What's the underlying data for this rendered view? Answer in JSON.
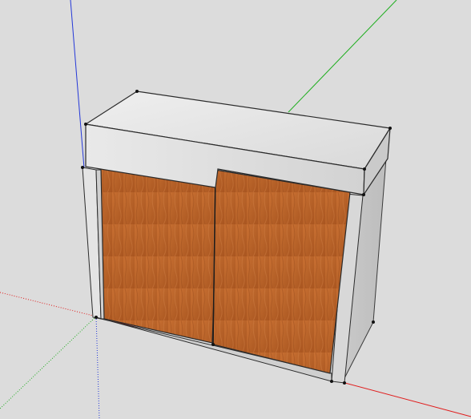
{
  "scene": {
    "background": "#dcdcdc",
    "axis_colors": {
      "red": "#e01b1b",
      "green": "#1fae1f",
      "blue": "#2438d8"
    },
    "materials": {
      "concrete": {
        "light": "#ededed",
        "mid": "#d6d6d6",
        "dark": "#b9b9b9"
      },
      "side_panel": {
        "light": "#e6e6e6",
        "dark": "#cbcbcb"
      },
      "wood": {
        "light": "#d07a3c",
        "mid": "#b7612a",
        "dark": "#8e4415"
      }
    }
  }
}
